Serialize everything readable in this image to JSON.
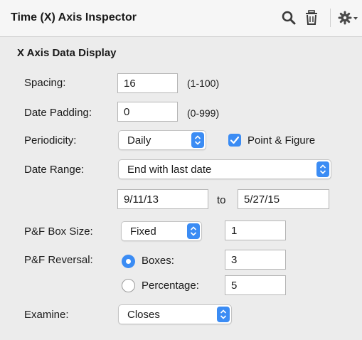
{
  "header": {
    "title": "Time (X) Axis Inspector",
    "icons": [
      "search-icon",
      "trash-icon",
      "gear-icon",
      "chevron-down-icon"
    ]
  },
  "section": {
    "title": "X Axis Data Display"
  },
  "spacing": {
    "label": "Spacing:",
    "value": "16",
    "hint": "(1-100)"
  },
  "date_padding": {
    "label": "Date Padding:",
    "value": "0",
    "hint": "(0-999)"
  },
  "periodicity": {
    "label": "Periodicity:",
    "value": "Daily",
    "checkbox_label": "Point & Figure",
    "checkbox_checked": true
  },
  "date_range": {
    "label": "Date Range:",
    "value": "End with last date",
    "start": "9/11/13",
    "to_label": "to",
    "end": "5/27/15"
  },
  "pf_box_size": {
    "label": "P&F Box Size:",
    "mode": "Fixed",
    "value": "1"
  },
  "pf_reversal": {
    "label": "P&F Reversal:",
    "boxes_label": "Boxes:",
    "boxes_value": "3",
    "boxes_selected": true,
    "percentage_label": "Percentage:",
    "percentage_value": "5"
  },
  "examine": {
    "label": "Examine:",
    "value": "Closes"
  },
  "colors": {
    "accent": "#3b8cf4",
    "panel": "#ececec",
    "header": "#f6f6f6"
  }
}
